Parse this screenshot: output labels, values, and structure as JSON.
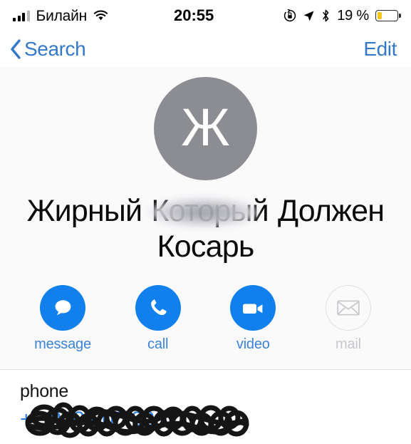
{
  "status_bar": {
    "carrier": "Билайн",
    "signal_bars_filled": 3,
    "signal_bars_total": 4,
    "wifi_icon": "wifi-icon",
    "time": "20:55",
    "rotation_lock_icon": "rotation-lock-icon",
    "location_icon": "location-arrow-icon",
    "bluetooth_icon": "bluetooth-icon",
    "battery_percent_label": "19 %",
    "battery_level": 19,
    "battery_fill_color": "#f5c518"
  },
  "nav_bar": {
    "back_icon": "chevron-left-icon",
    "back_label": "Search",
    "edit_label": "Edit",
    "tint_color": "#3478c8"
  },
  "contact": {
    "avatar_initial": "Ж",
    "avatar_color": "#8c8c93",
    "name": "Жирный            Который Должен Косарь",
    "name_redacted": true
  },
  "actions": [
    {
      "id": "message",
      "label": "message",
      "icon": "message-bubble-icon",
      "enabled": true
    },
    {
      "id": "call",
      "label": "call",
      "icon": "phone-handset-icon",
      "enabled": true
    },
    {
      "id": "video",
      "label": "video",
      "icon": "video-camera-icon",
      "enabled": true
    },
    {
      "id": "mail",
      "label": "mail",
      "icon": "envelope-icon",
      "enabled": false
    }
  ],
  "fields": [
    {
      "label": "phone",
      "value": "+7 900 000 00 00",
      "redacted": true
    }
  ],
  "colors": {
    "ios_blue": "#1180ed",
    "link_blue": "#3478c8",
    "card_background": "#fafafb",
    "disabled_gray": "#c7c7cc"
  }
}
